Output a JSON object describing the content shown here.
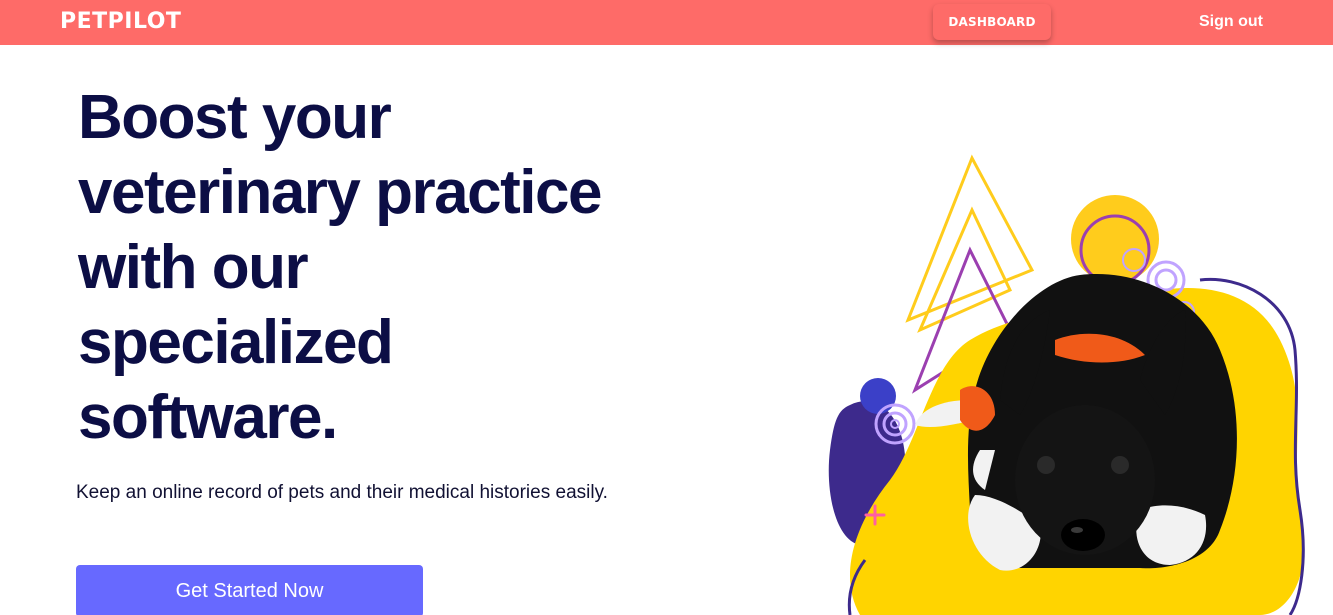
{
  "header": {
    "brand": "PETPILOT",
    "dashboard_label": "DASHBOARD",
    "signout_label": "Sign out"
  },
  "hero": {
    "headline_lines": [
      "Boost your",
      "veterinary practice",
      "with our",
      "specialized",
      "software."
    ],
    "subtext": "Keep an online record of pets and their medical histories easily.",
    "cta_label": "Get Started Now"
  },
  "colors": {
    "nav_bg": "#fe6b68",
    "headline": "#0c0e45",
    "cta_bg": "#6769ff",
    "yellow": "#ffd400",
    "purple": "#3d2a8c"
  },
  "illustration": {
    "icon": "dog-illustration"
  }
}
